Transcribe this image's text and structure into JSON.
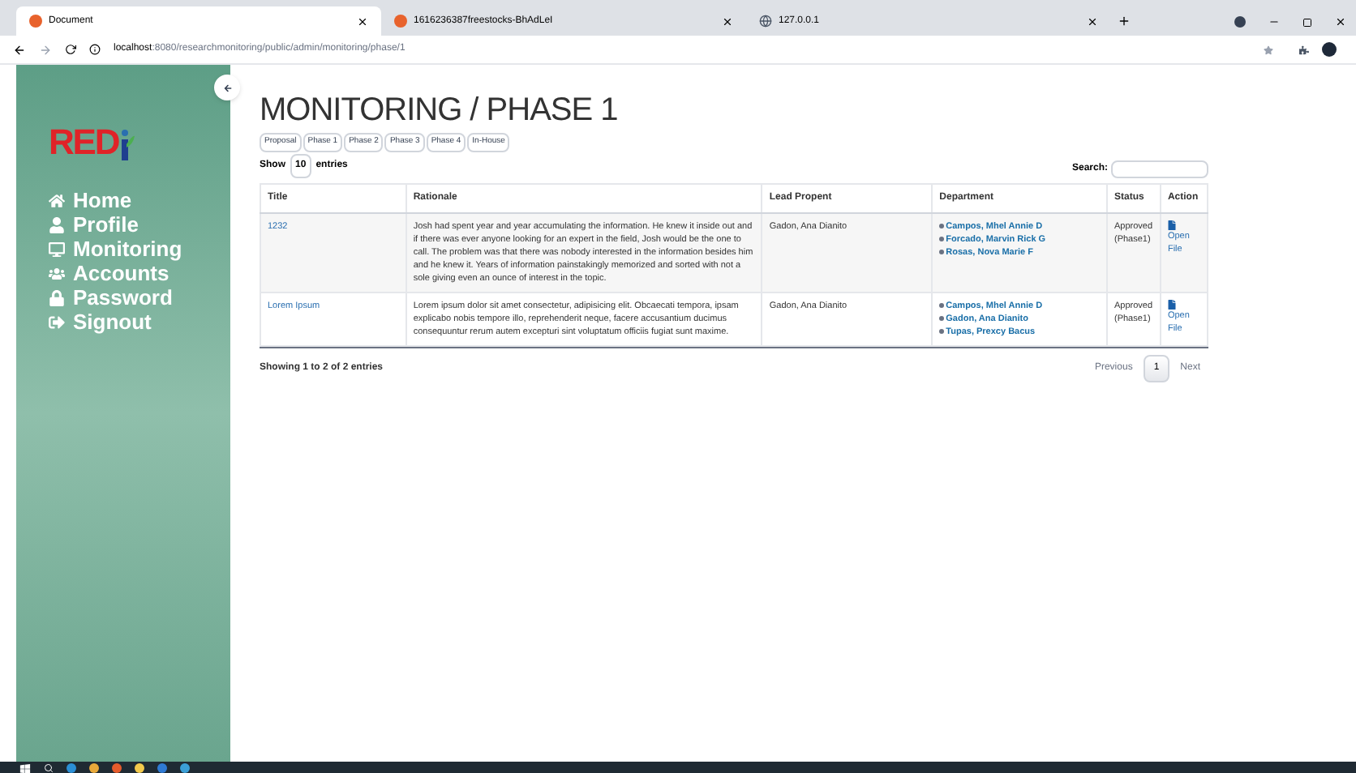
{
  "browser": {
    "tabs": [
      {
        "title": "Document",
        "selected": true
      },
      {
        "title": "1616236387freestocks-BhAdLeI",
        "selected": false
      },
      {
        "title": "127.0.0.1",
        "selected": false
      }
    ],
    "url_host": "localhost",
    "url_rest": ":8080/researchmonitoring/public/admin/monitoring/phase/1"
  },
  "sidebar": {
    "logo": "RED",
    "items": [
      {
        "label": "Home",
        "kind": "home"
      },
      {
        "label": "Profile",
        "kind": "profile"
      },
      {
        "label": "Monitoring",
        "kind": "monitoring"
      },
      {
        "label": "Accounts",
        "kind": "accounts"
      },
      {
        "label": "Password",
        "kind": "password"
      },
      {
        "label": "Signout",
        "kind": "signout"
      }
    ]
  },
  "page": {
    "title": "MONITORING / PHASE 1",
    "phase_buttons": [
      "Proposal",
      "Phase 1",
      "Phase 2",
      "Phase 3",
      "Phase 4",
      "In-House"
    ],
    "show_label": "Show",
    "entries_value": "10",
    "entries_label": "entries",
    "search_label": "Search:"
  },
  "table": {
    "columns": [
      "Title",
      "Rationale",
      "Lead Propent",
      "Department",
      "Status",
      "Action"
    ],
    "rows": [
      {
        "title": "1232",
        "rationale": "Josh had spent year and year accumulating the information. He knew it inside out and if there was ever anyone looking for an expert in the field, Josh would be the one to call. The problem was that there was nobody interested in the information besides him and he knew it. Years of information painstakingly memorized and sorted with not a sole giving even an ounce of interest in the topic.",
        "lead": "Gadon, Ana Dianito",
        "department": [
          "Campos, Mhel Annie D",
          "Forcado, Marvin Rick G",
          "Rosas, Nova Marie F"
        ],
        "status": "Approved (Phase1)",
        "action": "Open File"
      },
      {
        "title": "Lorem Ipsum",
        "rationale": "Lorem ipsum dolor sit amet consectetur, adipisicing elit. Obcaecati tempora, ipsam explicabo nobis tempore illo, reprehenderit neque, facere accusantium ducimus consequuntur rerum autem excepturi sint voluptatum officiis fugiat sunt maxime.",
        "lead": "Gadon, Ana Dianito",
        "department": [
          "Campos, Mhel Annie D",
          "Gadon, Ana Dianito",
          "Tupas, Prexcy Bacus"
        ],
        "status": "Approved (Phase1)",
        "action": "Open File"
      }
    ]
  },
  "footer": {
    "info": "Showing 1 to 2 of 2 entries",
    "pages": [
      {
        "label": "Previous",
        "selected": false
      },
      {
        "label": "1",
        "selected": true
      },
      {
        "label": "Next",
        "selected": false
      }
    ]
  }
}
